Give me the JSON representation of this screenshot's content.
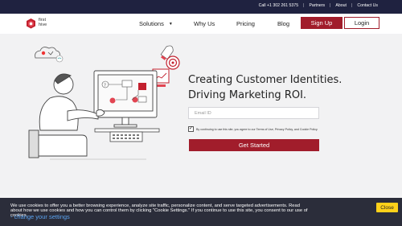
{
  "topbar": {
    "phone": "Call +1 302 261 5375",
    "partners": "Partners",
    "about": "About",
    "contact": "Contact Us"
  },
  "logo": {
    "line1": "first",
    "line2": "hive"
  },
  "nav": {
    "solutions": "Solutions",
    "why_us": "Why Us",
    "pricing": "Pricing",
    "blog": "Blog",
    "signup": "Sign Up",
    "login": "Login"
  },
  "hero": {
    "headline_line1": "Creating Customer Identities.",
    "headline_line2": "Driving Marketing ROI.",
    "email_placeholder": "Email ID",
    "consent_text": "By continuing to use this site, you agree to our Terms of Use, Privacy Policy, and Cookie Policy.",
    "consent_checked": true,
    "cta": "Get Started"
  },
  "cookie_banner": {
    "message": "We use cookies to offer you a better browsing experience, analyze site traffic, personalize content, and serve targeted advertisements. Read about how we use cookies and how you can control them by clicking \"Cookie Settings.\" If you continue to use this site, you consent to our use of cookies.",
    "change_settings": "- change your settings",
    "close": "Close"
  },
  "colors": {
    "brand_red": "#a11d2b",
    "topbar_navy": "#1f2240",
    "cookie_bg": "#2b2d3a",
    "close_yellow": "#ffd11a",
    "link_blue": "#5ba3f0"
  }
}
